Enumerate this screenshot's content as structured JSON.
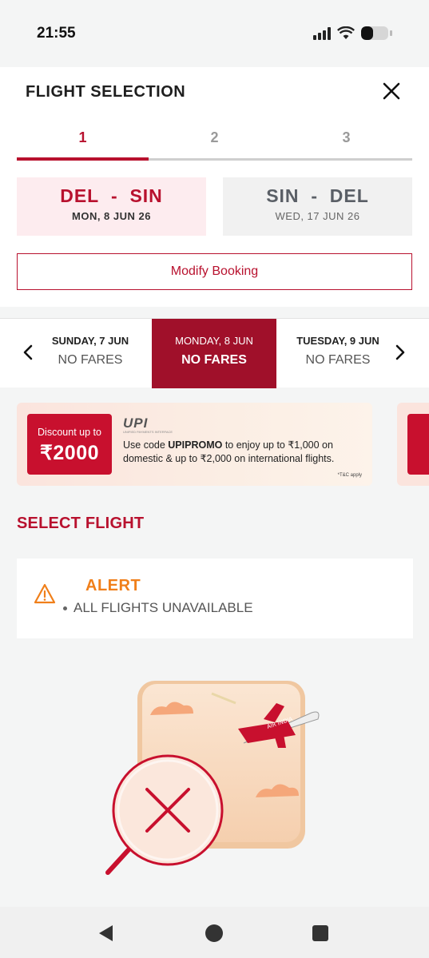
{
  "status_bar": {
    "time": "21:55",
    "battery_level": 0.45
  },
  "header": {
    "title": "FLIGHT SELECTION",
    "close_icon": "close-icon"
  },
  "steps": [
    {
      "label": "1",
      "active": true
    },
    {
      "label": "2",
      "active": false
    },
    {
      "label": "3",
      "active": false
    }
  ],
  "routes": [
    {
      "from": "DEL",
      "separator": "-",
      "to": "SIN",
      "date": "MON, 8 JUN 26",
      "active": true
    },
    {
      "from": "SIN",
      "separator": "-",
      "to": "DEL",
      "date": "WED, 17 JUN 26",
      "active": false
    }
  ],
  "modify_button": {
    "label": "Modify Booking"
  },
  "date_strip": {
    "days": [
      {
        "day": "SUNDAY, 7 JUN",
        "fare": "NO FARES",
        "active": false
      },
      {
        "day": "MONDAY, 8 JUN",
        "fare": "NO FARES",
        "active": true
      },
      {
        "day": "TUESDAY, 9 JUN",
        "fare": "NO FARES",
        "active": false
      }
    ]
  },
  "promo": {
    "badge_line1": "Discount up to",
    "badge_line2": "₹2000",
    "logo": "UPI",
    "logo_sub": "UNIFIED PAYMENTS INTERFACE",
    "text_before": "Use code ",
    "code": "UPIPROMO",
    "text_after": " to enjoy up to ₹1,000 on domestic & up to ₹2,000 on international flights.",
    "tc": "*T&C apply"
  },
  "select_flight": {
    "title": "SELECT FLIGHT"
  },
  "alert": {
    "title": "ALERT",
    "items": [
      "ALL FLIGHTS UNAVAILABLE"
    ]
  },
  "colors": {
    "brand": "#b8112e",
    "alert": "#f07f1a",
    "active_date": "#a0102a"
  }
}
